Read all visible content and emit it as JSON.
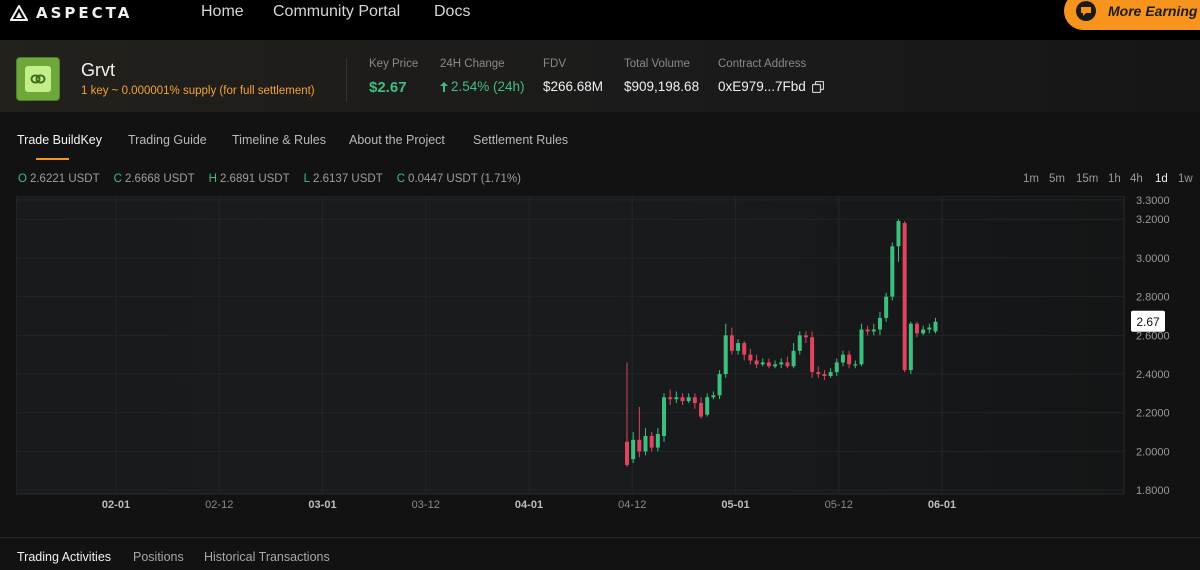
{
  "app": {
    "logo_text": "ASPECTA"
  },
  "nav": [
    {
      "label": "Home"
    },
    {
      "label": "Community Portal"
    },
    {
      "label": "Docs"
    }
  ],
  "earn_button": {
    "label": "More Earning C"
  },
  "token": {
    "name": "Grvt",
    "supply_note": "1 key ~ 0.000001% supply (for full settlement)"
  },
  "stats": [
    {
      "label": "Key Price",
      "value": "$2.67"
    },
    {
      "label": "24H Change",
      "value": "2.54% (24h)"
    },
    {
      "label": "FDV",
      "value": "$266.68M"
    },
    {
      "label": "Total Volume",
      "value": "$909,198.68"
    },
    {
      "label": "Contract Address",
      "value": "0xE979...7Fbd"
    }
  ],
  "tabs": [
    {
      "label": "Trade BuildKey"
    },
    {
      "label": "Trading Guide"
    },
    {
      "label": "Timeline & Rules"
    },
    {
      "label": "About the Project"
    },
    {
      "label": "Settlement Rules"
    }
  ],
  "ohlc": {
    "o_key": "O",
    "o_val": "2.6221 USDT",
    "c_key": "C",
    "c_val": "2.6668 USDT",
    "h_key": "H",
    "h_val": "2.6891 USDT",
    "l_key": "L",
    "l_val": "2.6137 USDT",
    "chg_key": "C",
    "chg_val": "0.0447 USDT (1.71%)"
  },
  "timeframes": [
    "1m",
    "5m",
    "15m",
    "1h",
    "4h",
    "1d",
    "1w"
  ],
  "active_timeframe": "1d",
  "colors": {
    "up": "#3fbf7f",
    "down": "#e0445e",
    "accent": "#f7941d"
  },
  "chart_data": {
    "type": "candlestick",
    "current_price_label": "2.67",
    "ylim": [
      1.78,
      3.32
    ],
    "y_ticks": [
      "3.3000",
      "3.2000",
      "3.0000",
      "2.8000",
      "2.6000",
      "2.4000",
      "2.2000",
      "2.0000",
      "1.8000"
    ],
    "x_ticks": [
      {
        "label": "02-01",
        "bold": true
      },
      {
        "label": "02-12",
        "bold": false
      },
      {
        "label": "03-01",
        "bold": true
      },
      {
        "label": "03-12",
        "bold": false
      },
      {
        "label": "04-01",
        "bold": true
      },
      {
        "label": "04-12",
        "bold": false
      },
      {
        "label": "05-01",
        "bold": true
      },
      {
        "label": "05-12",
        "bold": false
      },
      {
        "label": "06-01",
        "bold": true
      }
    ],
    "candles": [
      [
        2.05,
        1.93,
        2.46,
        1.92
      ],
      [
        1.96,
        2.06,
        2.1,
        1.94
      ],
      [
        2.06,
        2.0,
        2.23,
        1.97
      ],
      [
        2.0,
        2.08,
        2.12,
        1.98
      ],
      [
        2.08,
        2.02,
        2.1,
        2.0
      ],
      [
        2.02,
        2.09,
        2.12,
        2.0
      ],
      [
        2.08,
        2.28,
        2.3,
        2.05
      ],
      [
        2.28,
        2.27,
        2.32,
        2.24
      ],
      [
        2.27,
        2.28,
        2.31,
        2.25
      ],
      [
        2.28,
        2.26,
        2.3,
        2.24
      ],
      [
        2.26,
        2.28,
        2.3,
        2.25
      ],
      [
        2.28,
        2.25,
        2.3,
        2.22
      ],
      [
        2.25,
        2.18,
        2.28,
        2.17
      ],
      [
        2.19,
        2.28,
        2.3,
        2.18
      ],
      [
        2.28,
        2.29,
        2.31,
        2.27
      ],
      [
        2.29,
        2.4,
        2.42,
        2.27
      ],
      [
        2.4,
        2.6,
        2.66,
        2.38
      ],
      [
        2.6,
        2.52,
        2.64,
        2.5
      ],
      [
        2.52,
        2.56,
        2.58,
        2.5
      ],
      [
        2.56,
        2.5,
        2.57,
        2.47
      ],
      [
        2.5,
        2.47,
        2.53,
        2.45
      ],
      [
        2.47,
        2.45,
        2.5,
        2.43
      ],
      [
        2.45,
        2.46,
        2.48,
        2.44
      ],
      [
        2.46,
        2.44,
        2.48,
        2.43
      ],
      [
        2.44,
        2.45,
        2.47,
        2.43
      ],
      [
        2.45,
        2.46,
        2.48,
        2.43
      ],
      [
        2.46,
        2.44,
        2.49,
        2.43
      ],
      [
        2.44,
        2.52,
        2.56,
        2.43
      ],
      [
        2.52,
        2.6,
        2.62,
        2.5
      ],
      [
        2.6,
        2.59,
        2.62,
        2.56
      ],
      [
        2.59,
        2.41,
        2.62,
        2.38
      ],
      [
        2.41,
        2.4,
        2.44,
        2.38
      ],
      [
        2.4,
        2.39,
        2.42,
        2.37
      ],
      [
        2.39,
        2.41,
        2.43,
        2.38
      ],
      [
        2.41,
        2.46,
        2.48,
        2.39
      ],
      [
        2.46,
        2.5,
        2.52,
        2.44
      ],
      [
        2.5,
        2.45,
        2.52,
        2.43
      ],
      [
        2.45,
        2.45,
        2.47,
        2.43
      ],
      [
        2.45,
        2.63,
        2.66,
        2.44
      ],
      [
        2.63,
        2.62,
        2.65,
        2.6
      ],
      [
        2.62,
        2.63,
        2.66,
        2.6
      ],
      [
        2.63,
        2.69,
        2.72,
        2.6
      ],
      [
        2.69,
        2.8,
        2.82,
        2.67
      ],
      [
        2.8,
        3.06,
        3.08,
        2.78
      ],
      [
        3.06,
        3.19,
        3.2,
        2.98
      ],
      [
        3.18,
        2.42,
        3.19,
        2.41
      ],
      [
        2.42,
        2.66,
        2.67,
        2.4
      ],
      [
        2.66,
        2.61,
        2.67,
        2.59
      ],
      [
        2.61,
        2.63,
        2.65,
        2.6
      ],
      [
        2.63,
        2.64,
        2.66,
        2.61
      ],
      [
        2.62,
        2.67,
        2.69,
        2.61
      ]
    ]
  },
  "bottom_tabs": [
    {
      "label": "Trading Activities"
    },
    {
      "label": "Positions"
    },
    {
      "label": "Historical Transactions"
    }
  ]
}
